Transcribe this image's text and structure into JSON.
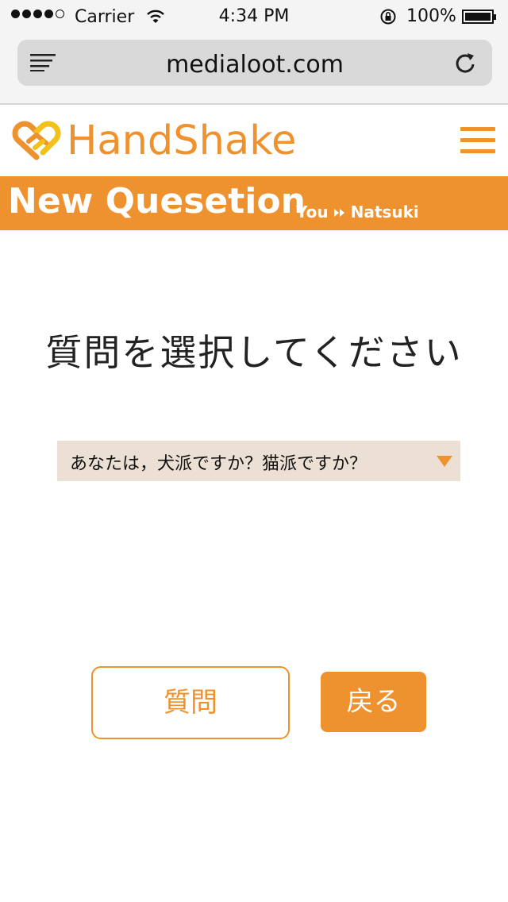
{
  "status_bar": {
    "carrier": "Carrier",
    "time": "4:34 PM",
    "battery": "100%"
  },
  "browser": {
    "url": "medialoot.com"
  },
  "header": {
    "brand": "HandShake"
  },
  "page": {
    "title": "New Quesetion",
    "breadcrumb_from": "You",
    "breadcrumb_to": "Natsuki"
  },
  "main": {
    "heading": "質問を選択してください",
    "select_value": "あなたは，犬派ですか？猫派ですか？",
    "ask_button": "質問",
    "back_button": "戻る"
  },
  "colors": {
    "accent": "#ee922f",
    "select_bg": "#ebe0d3"
  },
  "icons": [
    "signal-icon",
    "wifi-icon",
    "lock-rotation-icon",
    "battery-icon",
    "reader-menu-icon",
    "reload-icon",
    "handshake-logo-icon",
    "hamburger-menu-icon",
    "double-arrow-icon",
    "dropdown-arrow-icon"
  ]
}
